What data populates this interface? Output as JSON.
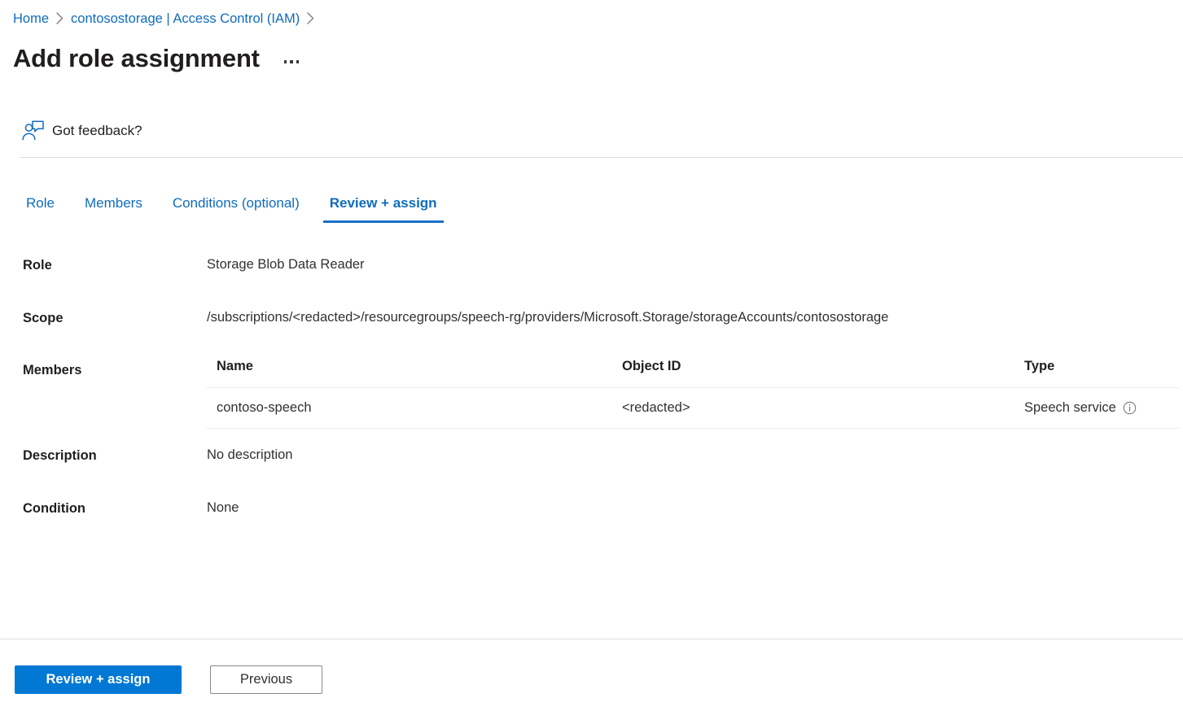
{
  "breadcrumb": {
    "items": [
      {
        "label": "Home"
      },
      {
        "label": "contosostorage | Access Control (IAM)"
      }
    ],
    "separator_icon": "chevron-right-icon"
  },
  "header": {
    "title": "Add role assignment",
    "more_menu_icon": "ellipsis-icon"
  },
  "feedback": {
    "label": "Got feedback?",
    "icon": "feedback-person-icon",
    "icon_color": "#0f6cbd"
  },
  "tabs": [
    {
      "label": "Role",
      "active": false
    },
    {
      "label": "Members",
      "active": false
    },
    {
      "label": "Conditions (optional)",
      "active": false
    },
    {
      "label": "Review + assign",
      "active": true
    }
  ],
  "summary": {
    "role": {
      "label": "Role",
      "value": "Storage Blob Data Reader"
    },
    "scope": {
      "label": "Scope",
      "value": "/subscriptions/<redacted>/resourcegroups/speech-rg/providers/Microsoft.Storage/storageAccounts/contosostorage"
    },
    "members": {
      "label": "Members",
      "columns": [
        "Name",
        "Object ID",
        "Type"
      ],
      "rows": [
        {
          "name": "contoso-speech",
          "object_id": "<redacted>",
          "type": "Speech service",
          "type_info_icon": "info-circle-icon"
        }
      ]
    },
    "description": {
      "label": "Description",
      "value": "No description"
    },
    "condition": {
      "label": "Condition",
      "value": "None"
    }
  },
  "footer": {
    "primary_button": "Review + assign",
    "secondary_button": "Previous"
  },
  "colors": {
    "link": "#0f6cbd",
    "primary_button": "#0078d4",
    "tab_underline": "#1a6fc4",
    "divider": "#e1dfdd",
    "text": "#323130"
  }
}
